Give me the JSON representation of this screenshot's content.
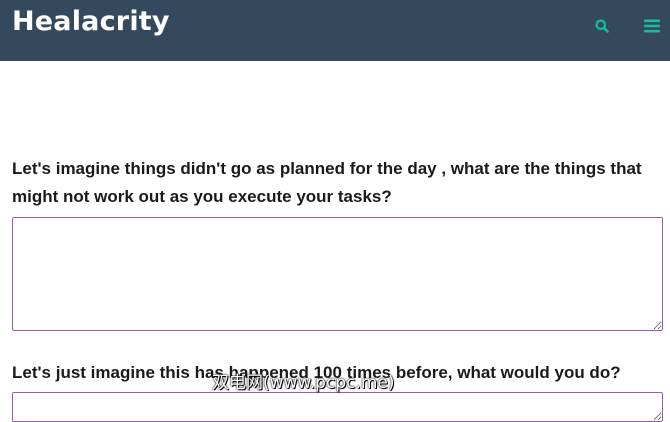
{
  "header": {
    "brand": "Healacrity",
    "search_icon": "search-icon",
    "menu_icon": "hamburger-menu-icon",
    "background_color": "#34495e",
    "icon_color": "#1abc9c"
  },
  "form": {
    "questions": [
      {
        "label": "Let's imagine things didn't go as planned for the day , what are the things that might not work out as you execute your tasks?",
        "value": ""
      },
      {
        "label": "Let's just imagine this has happened 100 times before, what would you do?",
        "value": ""
      }
    ],
    "field_border_color": "#9b59b6"
  },
  "watermark": {
    "text": "双电网(www.pcpc.me)"
  }
}
